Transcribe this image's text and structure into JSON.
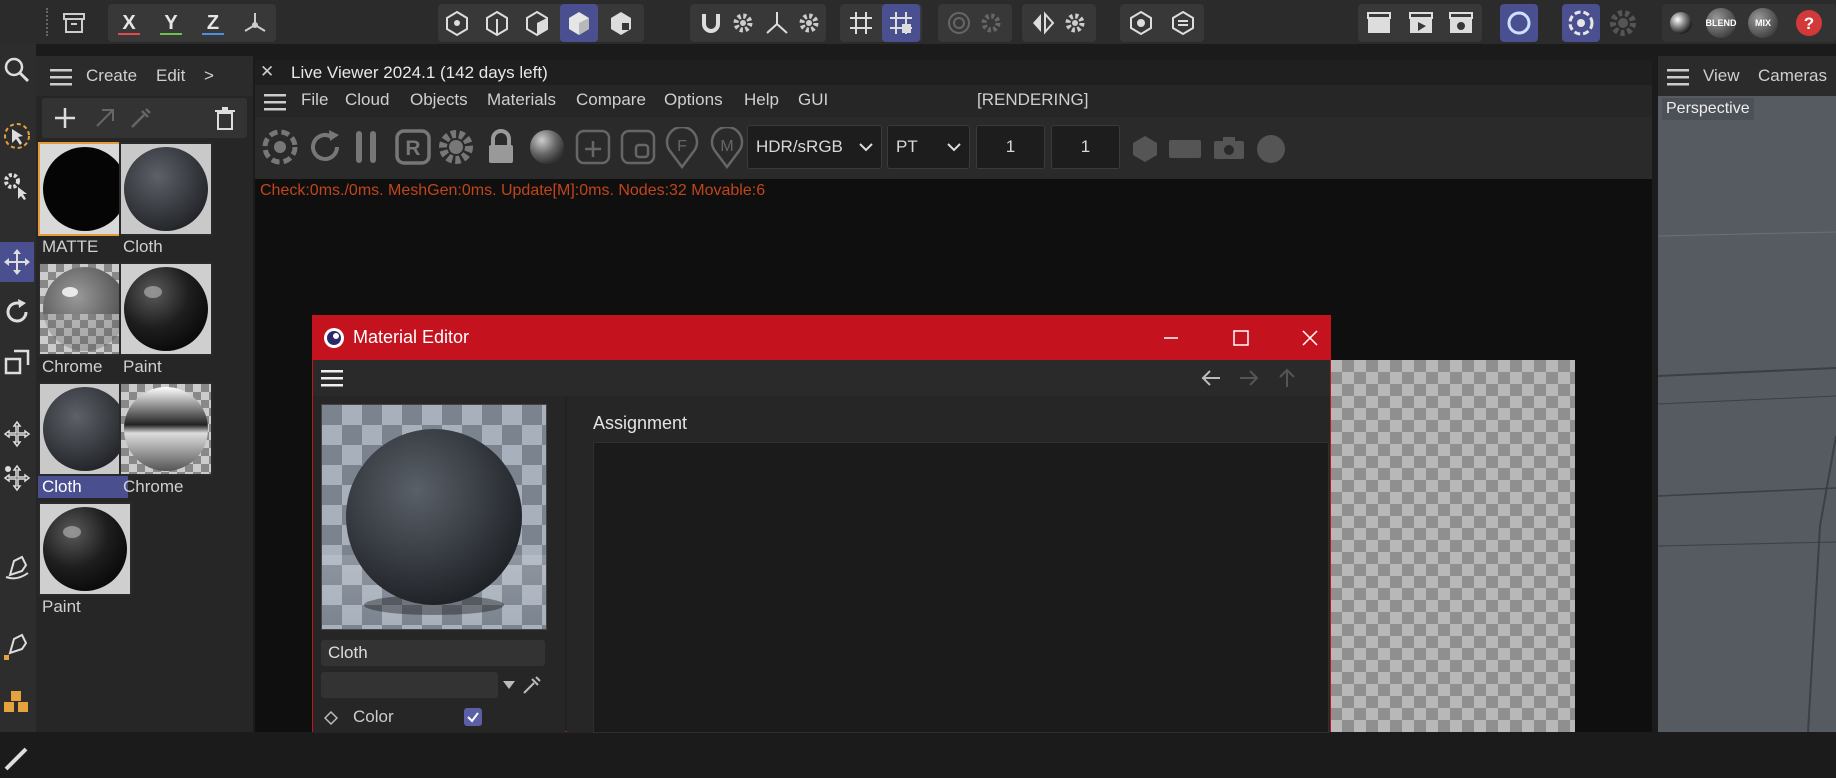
{
  "topbar": {
    "axes": [
      "X",
      "Y",
      "Z"
    ],
    "axis_colors": [
      "#e04b4b",
      "#6cc24a",
      "#4a8fe0"
    ],
    "icons": [
      "archive-icon",
      "x-axis-icon",
      "y-axis-icon",
      "z-axis-icon",
      "coordinate-system-icon",
      "point-mode-icon",
      "edge-mode-icon",
      "polygon-mode-icon",
      "model-mode-icon",
      "texture-mode-icon",
      "magnet-icon",
      "snap-settings-icon",
      "axis-icon",
      "axis-settings-icon",
      "grid-icon",
      "snap-grid-icon",
      "target-icon",
      "target-settings-icon",
      "symmetry-icon",
      "symmetry-settings-icon",
      "view-icon",
      "render-view-icon",
      "clapboard-icon",
      "render-play-icon",
      "render-settings-icon",
      "octane-icon",
      "octane-aperture-icon",
      "gear-icon",
      "sphere-icon",
      "blend-icon",
      "mix-icon",
      "help-icon"
    ],
    "badges": [
      "BLEND",
      "MIX"
    ]
  },
  "material_manager": {
    "menu": [
      "Create",
      "Edit",
      ">"
    ],
    "materials": [
      {
        "label": "MATTE",
        "kind": "black",
        "selected": false,
        "outline": true
      },
      {
        "label": "Cloth",
        "kind": "cloth",
        "selected": false
      },
      {
        "label": "Chrome",
        "kind": "chrome-check",
        "selected": false
      },
      {
        "label": "Paint",
        "kind": "paint",
        "selected": false
      },
      {
        "label": "Cloth",
        "kind": "cloth",
        "selected": true
      },
      {
        "label": "Chrome",
        "kind": "chrome",
        "selected": false
      },
      {
        "label": "Paint",
        "kind": "paint",
        "selected": false
      }
    ]
  },
  "live_viewer": {
    "title": "Live Viewer 2024.1 (142 days left)",
    "menu": [
      "File",
      "Cloud",
      "Objects",
      "Materials",
      "Compare",
      "Options",
      "Help",
      "GUI"
    ],
    "render_state": "[RENDERING]",
    "color_space": "HDR/sRGB",
    "kernel": "PT",
    "field1": "1",
    "field2": "1",
    "status": "Check:0ms./0ms. MeshGen:0ms. Update[M]:0ms. Nodes:32 Movable:6",
    "status_color": "#c0451c"
  },
  "right_viewport": {
    "menu": [
      "View",
      "Cameras"
    ],
    "label": "Perspective"
  },
  "material_editor": {
    "title": "Material Editor",
    "title_color": "#c4121e",
    "name": "Cloth",
    "second_field": "",
    "channel": "Color",
    "channel_checked": true,
    "section": "Assignment"
  }
}
